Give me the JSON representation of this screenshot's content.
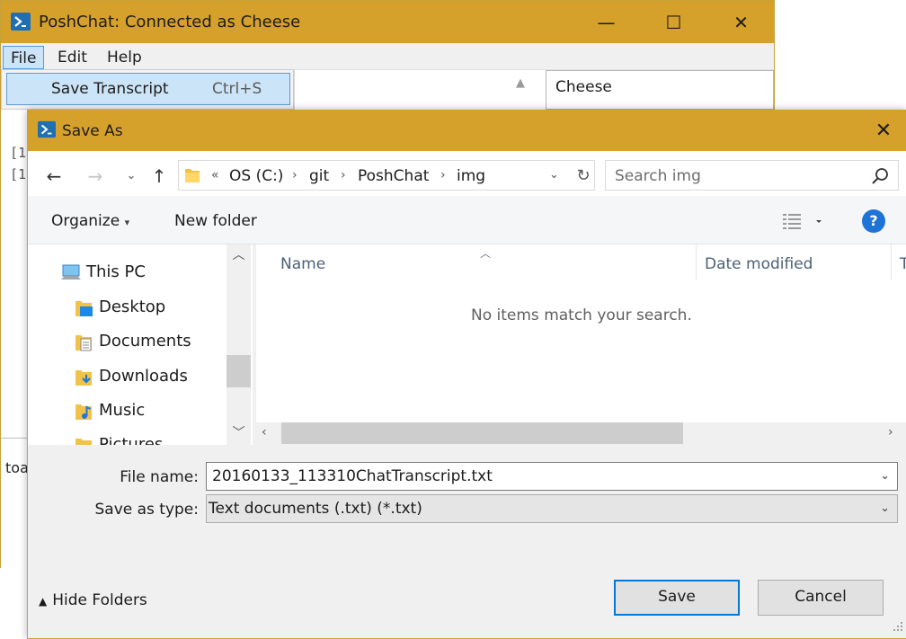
{
  "chat_window": {
    "title": "PoshChat: Connected as Cheese",
    "menu": [
      "File",
      "Edit",
      "Help"
    ],
    "file_menu_item": {
      "label": "Save Transcript",
      "shortcut": "Ctrl+S"
    },
    "users": [
      "Cheese"
    ],
    "log_snippets": [
      "[1",
      "[1"
    ],
    "input_snippet": "toa"
  },
  "dialog": {
    "title": "Save As",
    "breadcrumb": [
      "OS (C:)",
      "git",
      "PoshChat",
      "img"
    ],
    "breadcrumb_overflow": "«",
    "search_placeholder": "Search img",
    "toolbar": {
      "organize": "Organize",
      "organize_caret": "▾",
      "new_folder": "New folder",
      "help": "?"
    },
    "nav_items": [
      {
        "label": "This PC",
        "icon": "computer-icon"
      },
      {
        "label": "Desktop",
        "icon": "desktop-folder-icon"
      },
      {
        "label": "Documents",
        "icon": "documents-folder-icon"
      },
      {
        "label": "Downloads",
        "icon": "downloads-folder-icon"
      },
      {
        "label": "Music",
        "icon": "music-folder-icon"
      },
      {
        "label": "Pictures",
        "icon": "pictures-folder-icon"
      }
    ],
    "columns": [
      "Name",
      "Date modified",
      "T"
    ],
    "empty_message": "No items match your search.",
    "file_name_label": "File name:",
    "file_name": "20160133_113310ChatTranscript.txt",
    "save_type_label": "Save as type:",
    "save_type": "Text documents (.txt) (*.txt)",
    "hide_folders": "Hide Folders",
    "save_button": "Save",
    "cancel_button": "Cancel"
  },
  "colors": {
    "title_bar": "#d6a12b",
    "accent": "#0078d7",
    "menu_highlight": "#cce4f7"
  }
}
